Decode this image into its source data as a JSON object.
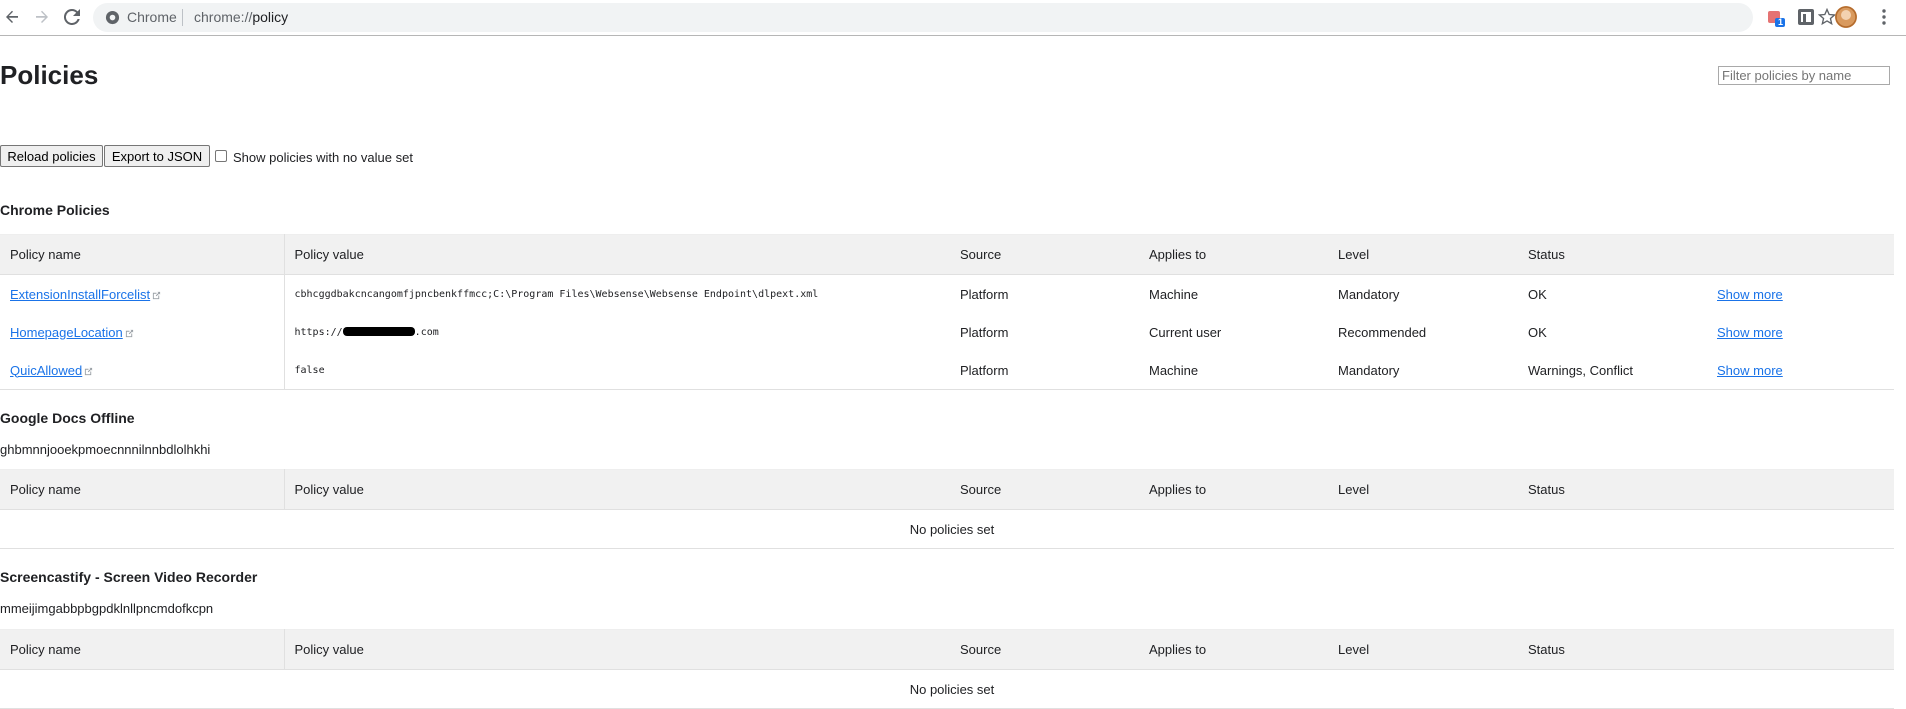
{
  "browser": {
    "chip_label": "Chrome",
    "url_scheme": "chrome://",
    "url_path": "policy",
    "ext_badge": "1"
  },
  "page": {
    "title": "Policies",
    "filter_placeholder": "Filter policies by name",
    "reload_label": "Reload policies",
    "export_label": "Export to JSON",
    "show_unset_label": "Show policies with no value set"
  },
  "columns": [
    "Policy name",
    "Policy value",
    "Source",
    "Applies to",
    "Level",
    "Status"
  ],
  "sections": [
    {
      "title": "Chrome Policies",
      "id": "",
      "rows": [
        {
          "name": "ExtensionInstallForcelist",
          "value": "cbhcggdbakcncangomfjpncbenkffmcc;C:\\Program Files\\Websense\\Websense Endpoint\\dlpext.xml",
          "source": "Platform",
          "applies_to": "Machine",
          "level": "Mandatory",
          "status": "OK",
          "more": "Show more"
        },
        {
          "name": "HomepageLocation",
          "value_prefix": "https://",
          "value_suffix": ".com",
          "source": "Platform",
          "applies_to": "Current user",
          "level": "Recommended",
          "status": "OK",
          "more": "Show more"
        },
        {
          "name": "QuicAllowed",
          "value": "false",
          "source": "Platform",
          "applies_to": "Machine",
          "level": "Mandatory",
          "status": "Warnings, Conflict",
          "more": "Show more"
        }
      ]
    },
    {
      "title": "Google Docs Offline",
      "id": "ghbmnnjooekpmoecnnnilnnbdlolhkhi",
      "empty": "No policies set"
    },
    {
      "title": "Screencastify - Screen Video Recorder",
      "id": "mmeijimgabbpbgpdklnllpncmdofkcpn",
      "empty": "No policies set"
    }
  ]
}
